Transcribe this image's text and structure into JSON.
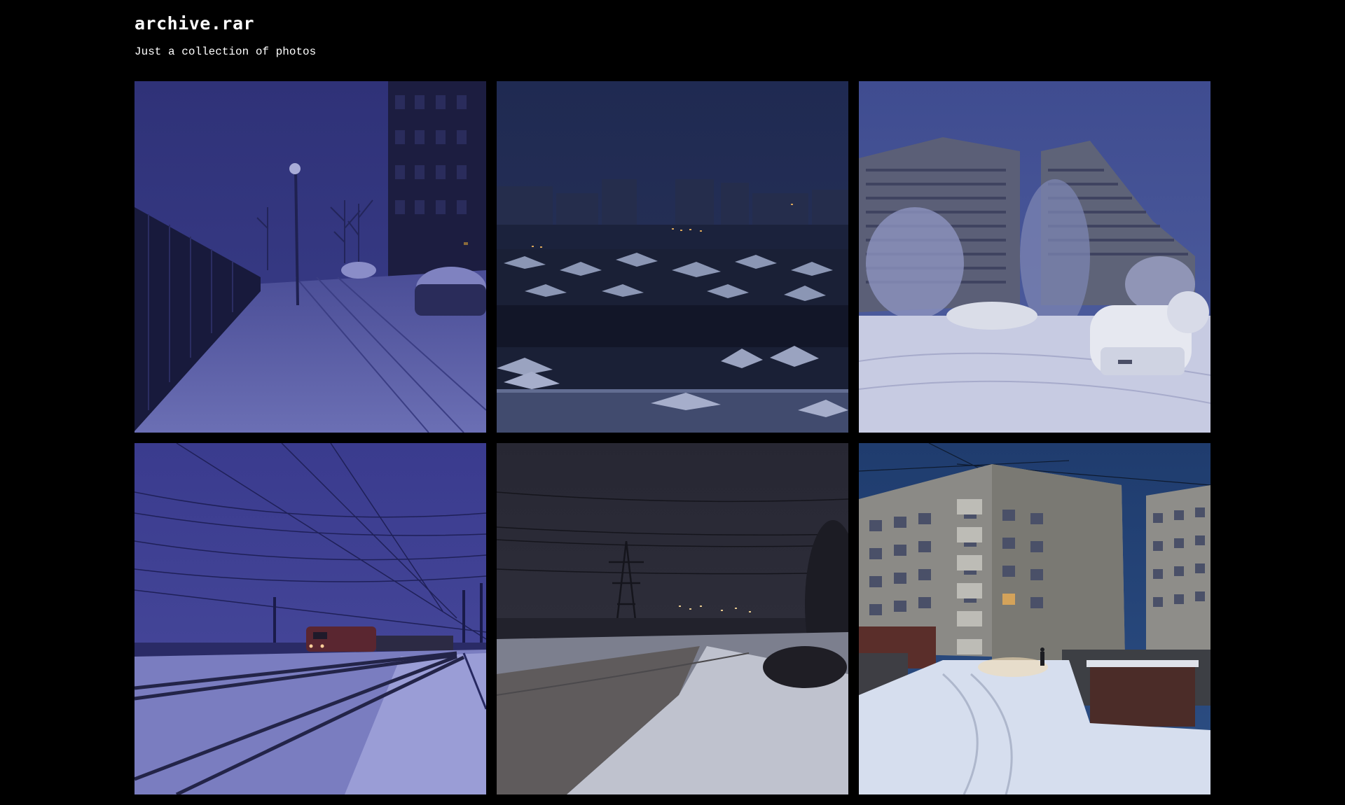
{
  "site": {
    "title": "archive.rar",
    "subtitle": "Just a collection of photos"
  },
  "colors": {
    "background": "#000000",
    "text": "#ffffff"
  },
  "photos": [
    {
      "subject": "snowy sidewalk with fence, street lamp and apartment tower at dusk"
    },
    {
      "subject": "dark winter city panorama over snowy rooftops"
    },
    {
      "subject": "snow-covered cars in courtyard of apartment blocks"
    },
    {
      "subject": "railway tracks in snow with red locomotive and overhead wires"
    },
    {
      "subject": "foggy snowy road with power pylon and distant city lights"
    },
    {
      "subject": "panel apartment buildings with snowy path and garages at twilight"
    }
  ]
}
